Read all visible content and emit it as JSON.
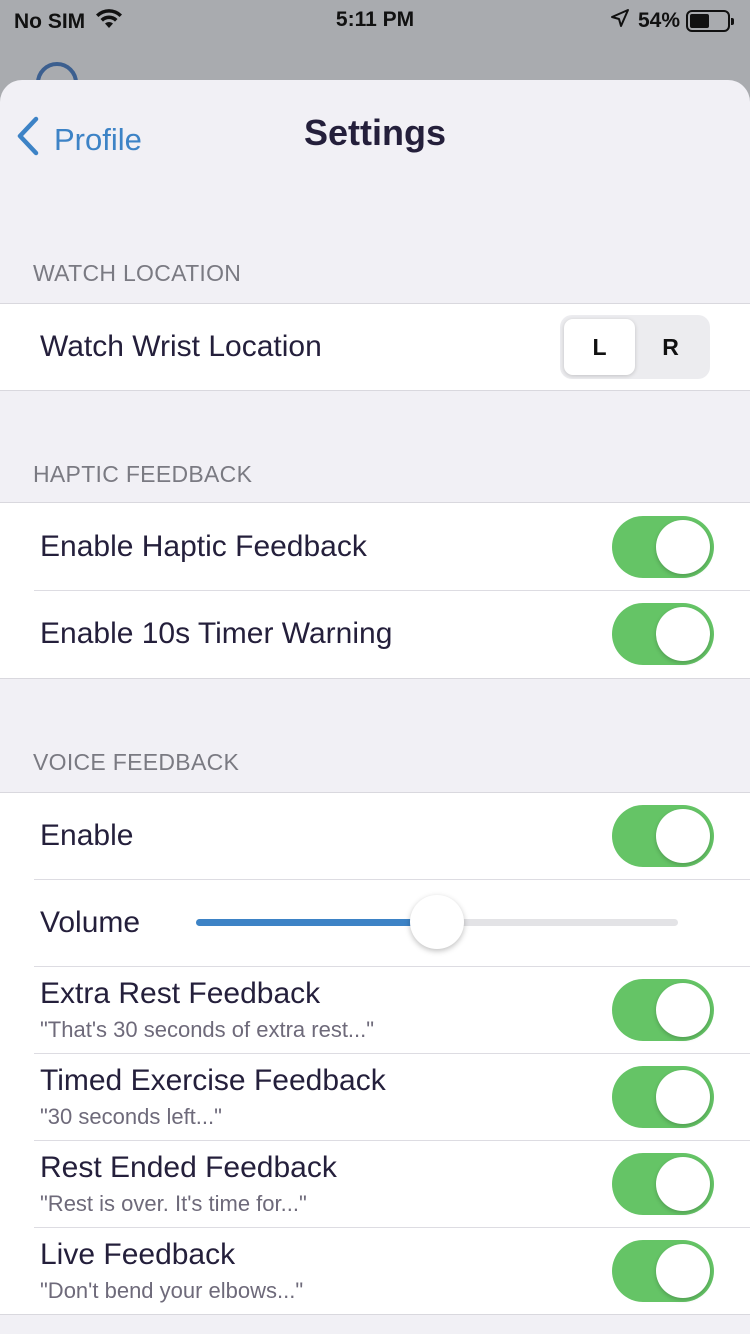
{
  "status_bar": {
    "carrier": "No SIM",
    "time": "5:11 PM",
    "battery_percent": "54%",
    "battery_level": 0.54,
    "icons": [
      "wifi-icon",
      "location-arrow-icon",
      "battery-icon"
    ]
  },
  "nav": {
    "back_label": "Profile",
    "title": "Settings"
  },
  "colors": {
    "accent": "#3d83c6",
    "toggle_on": "#65c466",
    "title_text": "#241f3b",
    "section_header_text": "#7a7a82",
    "background": "#f1f0f5"
  },
  "sections": {
    "watch": {
      "header": "WATCH LOCATION",
      "wrist_label": "Watch Wrist Location",
      "options": [
        "L",
        "R"
      ],
      "selected": "L"
    },
    "haptic": {
      "header": "HAPTIC FEEDBACK",
      "enable_label": "Enable Haptic Feedback",
      "enable_on": true,
      "timer_label": "Enable 10s Timer Warning",
      "timer_on": true
    },
    "voice": {
      "header": "VOICE FEEDBACK",
      "enable_label": "Enable",
      "enable_on": true,
      "volume_label": "Volume",
      "volume_level": 0.5,
      "items": [
        {
          "label": "Extra Rest Feedback",
          "subtitle": "\"That's 30 seconds of extra rest...\"",
          "on": true
        },
        {
          "label": "Timed Exercise Feedback",
          "subtitle": "\"30 seconds left...\"",
          "on": true
        },
        {
          "label": "Rest Ended Feedback",
          "subtitle": "\"Rest is over. It's time for...\"",
          "on": true
        },
        {
          "label": "Live Feedback",
          "subtitle": "\"Don't bend your elbows...\"",
          "on": true
        }
      ]
    }
  }
}
